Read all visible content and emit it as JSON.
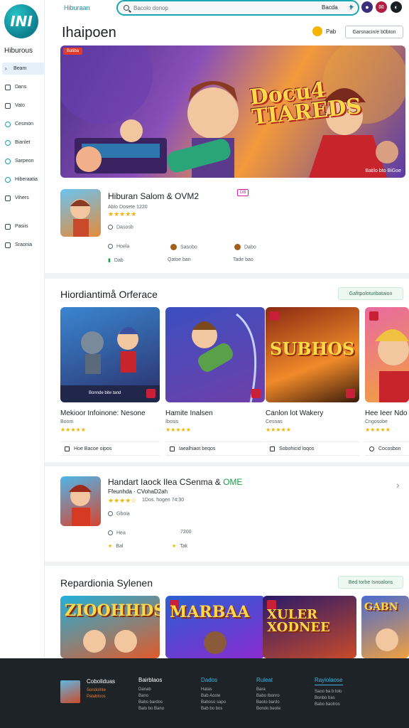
{
  "sidebar": {
    "logo_text": "INI",
    "brand": "Hiburous",
    "items": [
      {
        "label": "Beam",
        "active": true
      },
      {
        "label": "Dans"
      },
      {
        "label": "Vato"
      },
      {
        "label": "Cesmon"
      },
      {
        "label": "Bianlet"
      },
      {
        "label": "Sarpeon"
      },
      {
        "label": "Hiberaatia"
      },
      {
        "label": "Vihers"
      },
      {
        "label": "Pasiis"
      },
      {
        "label": "Sraonia"
      }
    ]
  },
  "topbar": {
    "link": "Hiburaan",
    "search_placeholder": "Bacolo donop",
    "right_label": "Bacda"
  },
  "header": {
    "title": "Ihaipoen",
    "label": "Pab",
    "button": "Garsnacin/e b0bton"
  },
  "hero": {
    "badge": "Batiba",
    "title_line1": "Docu4",
    "title_line2": "TIAREDS",
    "corner_text": "Batilo bto BiGoe"
  },
  "featured": {
    "title": "Hiburan Salom & OVM2",
    "badge": "DB",
    "rating_text": "Ablo Dosete 1220",
    "meta": "Dasosb",
    "stats_labels": [
      "Hoela",
      "Sasobo",
      "Dabo"
    ],
    "stats_values": [
      "Dab",
      "Qatoe ban",
      "Tade bao"
    ]
  },
  "section1": {
    "title": "Hiordiantimå Orferace",
    "button": "Gafitpoloturibataion",
    "cards": [
      {
        "title": "Mekioor Infoinone: Nesone",
        "sub": "Boom",
        "caption": "Bonnde bite tand",
        "action": "Hoe Bacoe oipos"
      },
      {
        "title": "Hamite Inalsen",
        "sub": "Ibosis",
        "caption": "",
        "action": "Iaealhiaot beqos"
      },
      {
        "title": "Canlon lot Wakery",
        "sub": "Cesnas",
        "caption": "SUBHOS",
        "action": "Sobohicid loqos"
      },
      {
        "title": "Hee Ieer Ndo",
        "sub": "Cngosobe",
        "caption": "",
        "action": "Cocosbon"
      }
    ]
  },
  "featured2": {
    "title_main": "Handart Iaock Ilea CSenma &",
    "title_highlight": "OME",
    "sub": "Ffeunhda · CVohaD2ah",
    "rating_text": "1Dos. hogen 74:30",
    "meta": "Gboia",
    "stat_label": "Hea",
    "stat_num": "7200",
    "stat_left": "Bal",
    "stat_right": "Tak"
  },
  "section2": {
    "title": "Repardionia Sylenen",
    "button": "Bed torbe Isnoalons",
    "cards": [
      {
        "caption": "ZIOOHHDS"
      },
      {
        "caption": "MARBAA"
      },
      {
        "caption": "XULER XODNEE"
      },
      {
        "caption": "GABN"
      }
    ]
  },
  "footer": {
    "brand": "Coboliduas",
    "sub_lines": [
      "Sondolnte",
      "Palabtoos"
    ],
    "columns": [
      {
        "head": "Bairblaos",
        "color": "#ffffff",
        "links": [
          "Danab",
          "Bano",
          "Babo bardos",
          "Balo bo Bano"
        ]
      },
      {
        "head": "Dados",
        "color": "#3fb3e0",
        "links": [
          "Hatas",
          "Bab Aoste",
          "Baboso sapo",
          "Bab bo bos"
        ]
      },
      {
        "head": "Ruleat",
        "color": "#3fb3e0",
        "links": [
          "Bara",
          "Babo Ibonro",
          "Baoto bardo",
          "Bondo beote"
        ]
      },
      {
        "head": "Rayiolaose",
        "color": "#3fb3e0",
        "links": [
          "Saoo ba b:lolo",
          "Bonbo bas",
          "Babo baotros"
        ]
      }
    ]
  },
  "colors": {
    "accent": "#1aa6b3",
    "star": "#f2b400",
    "footer_bg": "#1e2327"
  }
}
